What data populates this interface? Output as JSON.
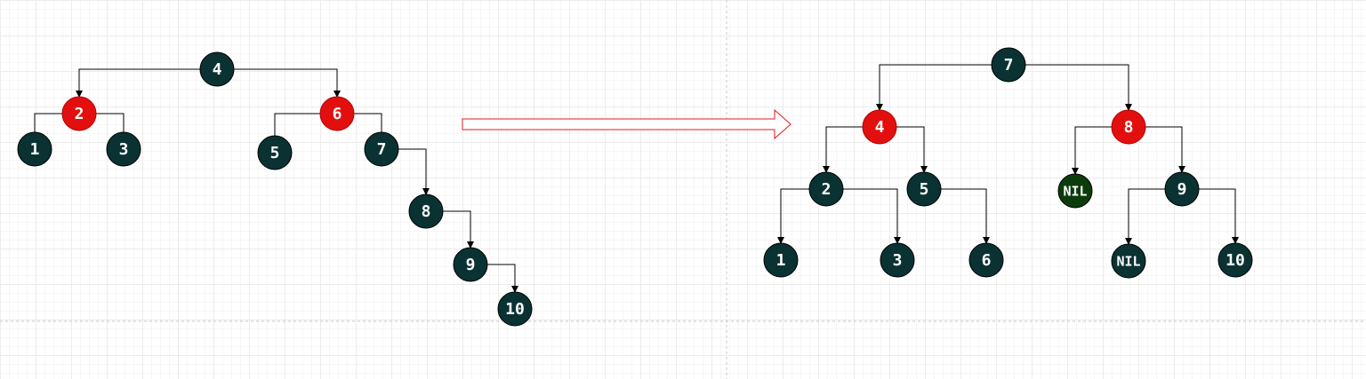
{
  "colors": {
    "black_node": "#0b3232",
    "red_node": "#e30f0f",
    "nil_node": "#0c3c0c",
    "edge": "#000000",
    "arrow_outline": "#e31b1b",
    "page_divider": "#c8c8c8"
  },
  "before_tree": {
    "nodes": [
      {
        "id": "b4",
        "label": "4",
        "color": "black"
      },
      {
        "id": "b2",
        "label": "2",
        "color": "red"
      },
      {
        "id": "b6",
        "label": "6",
        "color": "red"
      },
      {
        "id": "b1",
        "label": "1",
        "color": "black"
      },
      {
        "id": "b3",
        "label": "3",
        "color": "black"
      },
      {
        "id": "b5",
        "label": "5",
        "color": "black"
      },
      {
        "id": "b7",
        "label": "7",
        "color": "black"
      },
      {
        "id": "b8",
        "label": "8",
        "color": "black"
      },
      {
        "id": "b9",
        "label": "9",
        "color": "black"
      },
      {
        "id": "b10",
        "label": "10",
        "color": "black"
      }
    ],
    "edges": [
      {
        "from": "b4",
        "to": "b2"
      },
      {
        "from": "b4",
        "to": "b6"
      },
      {
        "from": "b2",
        "to": "b1"
      },
      {
        "from": "b2",
        "to": "b3"
      },
      {
        "from": "b6",
        "to": "b5"
      },
      {
        "from": "b6",
        "to": "b7"
      },
      {
        "from": "b7",
        "to": "b8"
      },
      {
        "from": "b8",
        "to": "b9"
      },
      {
        "from": "b9",
        "to": "b10"
      }
    ]
  },
  "after_tree": {
    "nodes": [
      {
        "id": "a7",
        "label": "7",
        "color": "black"
      },
      {
        "id": "a4",
        "label": "4",
        "color": "red"
      },
      {
        "id": "a8",
        "label": "8",
        "color": "red"
      },
      {
        "id": "a2",
        "label": "2",
        "color": "black"
      },
      {
        "id": "a5",
        "label": "5",
        "color": "black"
      },
      {
        "id": "anil1",
        "label": "NIL",
        "color": "nil"
      },
      {
        "id": "a9",
        "label": "9",
        "color": "black"
      },
      {
        "id": "a1",
        "label": "1",
        "color": "black"
      },
      {
        "id": "a3",
        "label": "3",
        "color": "black"
      },
      {
        "id": "a6",
        "label": "6",
        "color": "black"
      },
      {
        "id": "anil2",
        "label": "NIL",
        "color": "black"
      },
      {
        "id": "a10",
        "label": "10",
        "color": "black"
      }
    ],
    "edges": [
      {
        "from": "a7",
        "to": "a4"
      },
      {
        "from": "a7",
        "to": "a8"
      },
      {
        "from": "a4",
        "to": "a2"
      },
      {
        "from": "a4",
        "to": "a5"
      },
      {
        "from": "a8",
        "to": "anil1"
      },
      {
        "from": "a8",
        "to": "a9"
      },
      {
        "from": "a2",
        "to": "a1"
      },
      {
        "from": "a2",
        "to": "a3"
      },
      {
        "from": "a5",
        "to": "a6"
      },
      {
        "from": "a9",
        "to": "anil2"
      },
      {
        "from": "a9",
        "to": "a10"
      }
    ]
  },
  "transition_arrow": {
    "icon": "right-arrow-icon"
  }
}
